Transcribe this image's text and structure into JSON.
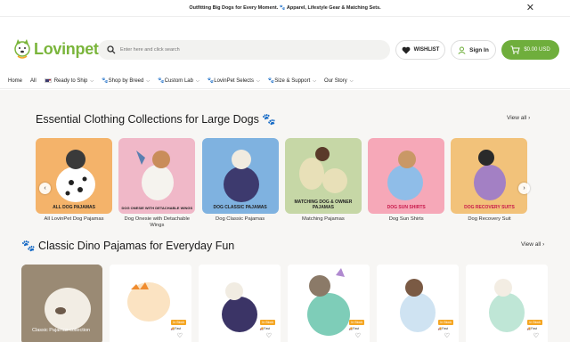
{
  "announcement": {
    "text": "Outfitting Big Dogs for Every Moment. 🐾 Apparel, Lifestyle Gear & Matching Sets."
  },
  "header": {
    "logo_text": "Lovinpet",
    "search_placeholder": "Enter here and click search",
    "wishlist_label": "WISHLIST",
    "signin_label": "Sign In",
    "cart_label": "$0.00 USD"
  },
  "nav": {
    "items": [
      {
        "label": "Home"
      },
      {
        "label": "All"
      },
      {
        "label": "Ready to Ship"
      },
      {
        "label": "🐾Shop by Breed"
      },
      {
        "label": "🐾Custom Lab"
      },
      {
        "label": "🐾LovinPet Selects"
      },
      {
        "label": "🐾Size & Support"
      },
      {
        "label": "Our Story"
      }
    ]
  },
  "section1": {
    "title": "Essential Clothing Collections for Large Dogs 🐾",
    "view_all": "View all",
    "collections": [
      {
        "label": "All LovinPet Dog Pajamas",
        "banner": "ALL DOG PAJAMAS",
        "color": "#f4b36a"
      },
      {
        "label": "Dog Onesie with Detachable Wings",
        "banner": "DOG ONESIE WITH DETACHABLE WINGS",
        "color": "#f0b8c8"
      },
      {
        "label": "Dog Classic Pajamas",
        "banner": "DOG CLASSIC PAJAMAS",
        "color": "#7fb2e0"
      },
      {
        "label": "Matching Pajamas",
        "banner": "MATCHING DOG & OWNER PAJAMAS",
        "color": "#c6d7a6"
      },
      {
        "label": "Dog Sun Shirts",
        "banner": "DOG SUN SHIRTS",
        "color": "#f6a8b8"
      },
      {
        "label": "Dog Recovery Suit",
        "banner": "DOG RECOVERY SUITS",
        "color": "#f2c27a"
      }
    ]
  },
  "section2": {
    "title": "🐾 Classic Dino Pajamas for Everyday Fun",
    "view_all": "View all",
    "promo_text": "Classic Pajamas collection",
    "fast_label": "Fast",
    "products": [
      {
        "tag": "In Stock",
        "color": "#fbe3c2"
      },
      {
        "tag": "In Stock",
        "color": "#e2dcef"
      },
      {
        "tag": "In Stock",
        "color": "#cfe9df"
      },
      {
        "tag": "In Stock",
        "color": "#dbe8f4"
      },
      {
        "tag": "In Stock",
        "color": "#d8efe6"
      }
    ]
  },
  "colors": {
    "brand_green": "#6fae3c",
    "logo_green": "#7ab53b",
    "tag_orange": "#f5a623"
  }
}
